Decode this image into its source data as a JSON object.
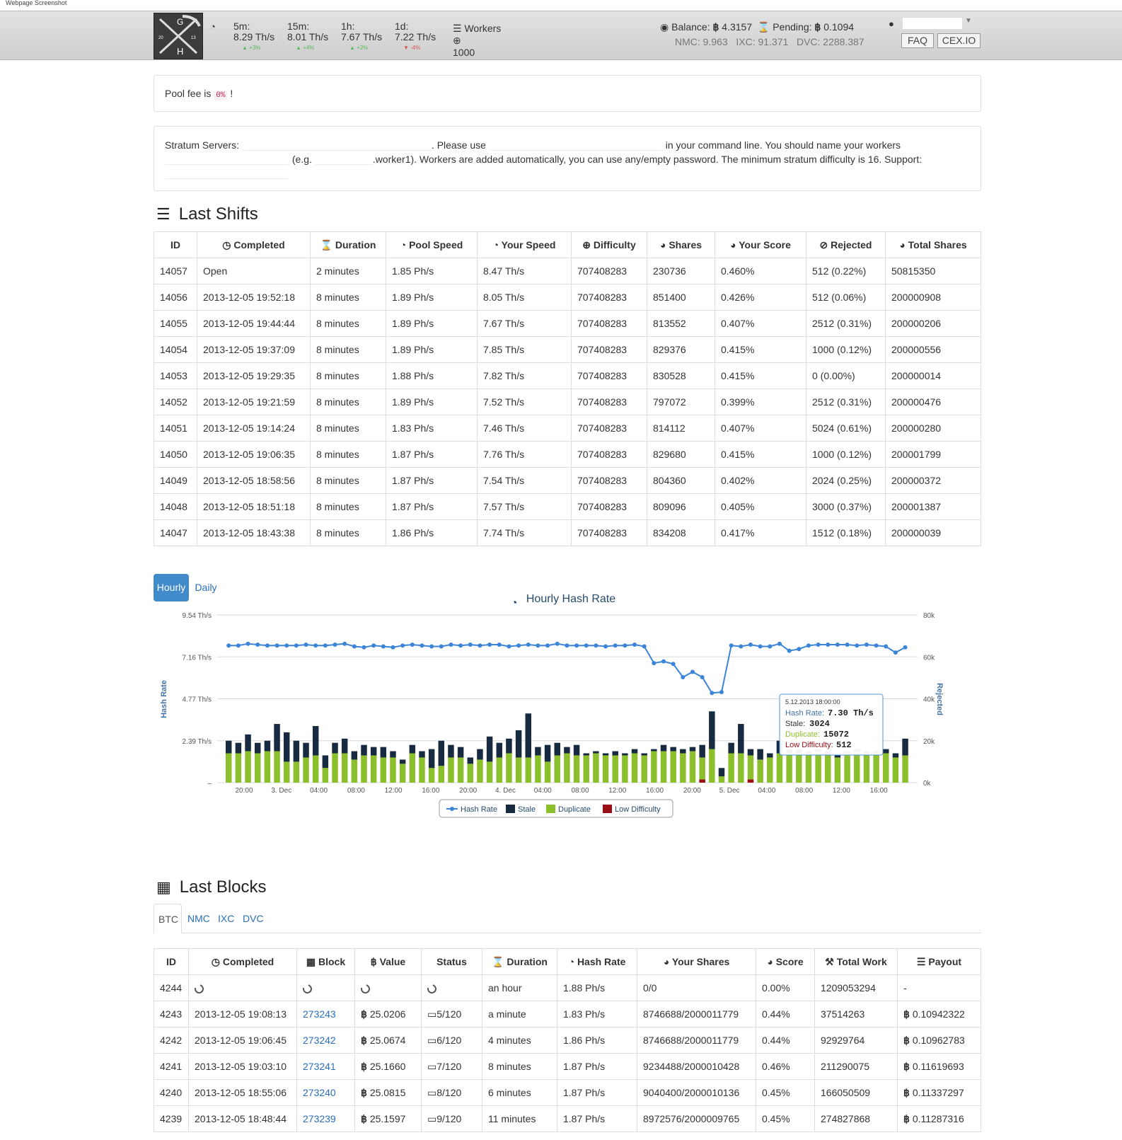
{
  "caption": "Webpage Screenshot",
  "header": {
    "stats": [
      {
        "label": "5m:",
        "value": "8.29 Th/s",
        "delta": "+3%",
        "dir": "up"
      },
      {
        "label": "15m:",
        "value": "8.01 Th/s",
        "delta": "+4%",
        "dir": "up"
      },
      {
        "label": "1h:",
        "value": "7.67 Th/s",
        "delta": "+2%",
        "dir": "up"
      },
      {
        "label": "1d:",
        "value": "7.22 Th/s",
        "delta": "-4%",
        "dir": "down"
      }
    ],
    "workers_label": "Workers",
    "workers_value": "1000",
    "balance_label": "Balance:",
    "balance_value": "4.3157",
    "pending_label": "Pending:",
    "pending_value": "0.1094",
    "alt_balances": "NMC: 9.963   IXC: 91.371   DVC: 2288.387",
    "faq_label": "FAQ",
    "cex_label": "CEX.IO",
    "user_value": ""
  },
  "fee_panel": {
    "prefix": "Pool fee is",
    "fee": "0%",
    "suffix": "!"
  },
  "stratum_panel": {
    "part1": "Stratum Servers:",
    "part2": ". Please use",
    "part3": "in your command line. You should name your workers",
    "part4": "(e.g.",
    "part5": ".worker1). Workers are added automatically, you can use any/empty password. The minimum stratum difficulty is 16. Support:"
  },
  "last_shifts": {
    "title": "Last Shifts",
    "columns": [
      "ID",
      "Completed",
      "Duration",
      "Pool Speed",
      "Your Speed",
      "Difficulty",
      "Shares",
      "Your Score",
      "Rejected",
      "Total Shares"
    ],
    "rows": [
      [
        "14057",
        "Open",
        "2 minutes",
        "1.85 Ph/s",
        "8.47 Th/s",
        "707408283",
        "230736",
        "0.460%",
        "512 (0.22%)",
        "50815350"
      ],
      [
        "14056",
        "2013-12-05 19:52:18",
        "8 minutes",
        "1.89 Ph/s",
        "8.05 Th/s",
        "707408283",
        "851400",
        "0.426%",
        "512 (0.06%)",
        "200000908"
      ],
      [
        "14055",
        "2013-12-05 19:44:44",
        "8 minutes",
        "1.89 Ph/s",
        "7.67 Th/s",
        "707408283",
        "813552",
        "0.407%",
        "2512 (0.31%)",
        "200000206"
      ],
      [
        "14054",
        "2013-12-05 19:37:09",
        "8 minutes",
        "1.89 Ph/s",
        "7.85 Th/s",
        "707408283",
        "829376",
        "0.415%",
        "1000 (0.12%)",
        "200000556"
      ],
      [
        "14053",
        "2013-12-05 19:29:35",
        "8 minutes",
        "1.88 Ph/s",
        "7.82 Th/s",
        "707408283",
        "830528",
        "0.415%",
        "0 (0.00%)",
        "200000014"
      ],
      [
        "14052",
        "2013-12-05 19:21:59",
        "8 minutes",
        "1.89 Ph/s",
        "7.52 Th/s",
        "707408283",
        "797072",
        "0.399%",
        "2512 (0.31%)",
        "200000476"
      ],
      [
        "14051",
        "2013-12-05 19:14:24",
        "8 minutes",
        "1.83 Ph/s",
        "7.46 Th/s",
        "707408283",
        "814112",
        "0.407%",
        "5024 (0.61%)",
        "200000280"
      ],
      [
        "14050",
        "2013-12-05 19:06:35",
        "8 minutes",
        "1.87 Ph/s",
        "7.76 Th/s",
        "707408283",
        "829680",
        "0.415%",
        "1000 (0.12%)",
        "200001799"
      ],
      [
        "14049",
        "2013-12-05 18:58:56",
        "8 minutes",
        "1.87 Ph/s",
        "7.54 Th/s",
        "707408283",
        "804360",
        "0.402%",
        "2024 (0.25%)",
        "200000372"
      ],
      [
        "14048",
        "2013-12-05 18:51:18",
        "8 minutes",
        "1.87 Ph/s",
        "7.57 Th/s",
        "707408283",
        "809096",
        "0.405%",
        "3000 (0.37%)",
        "200001387"
      ],
      [
        "14047",
        "2013-12-05 18:43:38",
        "8 minutes",
        "1.86 Ph/s",
        "7.74 Th/s",
        "707408283",
        "834208",
        "0.417%",
        "1512 (0.18%)",
        "200000039"
      ]
    ]
  },
  "chart_tabs": [
    "Hourly",
    "Daily"
  ],
  "chart_data": {
    "type": "line",
    "title": "Hourly Hash Rate",
    "ylabel": "Hash Rate",
    "y2label": "Rejected",
    "yticks": [
      "9.54 Th/s",
      "7.16 Th/s",
      "4.77 Th/s",
      "2.39 Th/s",
      "–"
    ],
    "y2ticks": [
      "80k",
      "60k",
      "40k",
      "20k",
      "0k"
    ],
    "ylim": [
      0,
      9.54
    ],
    "y2lim": [
      0,
      80000
    ],
    "xticks": [
      "20:00",
      "3. Dec",
      "04:00",
      "08:00",
      "12:00",
      "16:00",
      "20:00",
      "4. Dec",
      "04:00",
      "08:00",
      "12:00",
      "16:00",
      "20:00",
      "5. Dec",
      "04:00",
      "08:00",
      "12:00",
      "16:00"
    ],
    "legend": [
      "Hash Rate",
      "Stale",
      "Duplicate",
      "Low Difficulty"
    ],
    "colors": {
      "hash": "#3b84d8",
      "stale": "#172a40",
      "dup": "#8cbf2c",
      "low": "#9b0c14"
    },
    "hash_rate": [
      7.8,
      7.8,
      7.9,
      7.85,
      7.8,
      7.8,
      7.8,
      7.8,
      7.85,
      7.8,
      7.8,
      7.85,
      7.9,
      7.75,
      7.7,
      7.8,
      7.75,
      7.7,
      7.8,
      7.85,
      7.8,
      7.75,
      7.75,
      7.85,
      7.8,
      7.85,
      7.8,
      7.85,
      7.85,
      7.75,
      7.8,
      7.85,
      7.8,
      7.8,
      7.9,
      7.8,
      7.8,
      7.8,
      7.8,
      7.75,
      7.8,
      7.8,
      7.85,
      7.75,
      6.8,
      6.9,
      6.75,
      6.0,
      6.3,
      6.0,
      5.1,
      5.15,
      7.8,
      7.75,
      7.85,
      7.75,
      7.75,
      7.9,
      7.5,
      7.6,
      7.8,
      7.85,
      7.85,
      7.85,
      7.85,
      7.8,
      7.85,
      7.8,
      7.75,
      7.4,
      7.7
    ],
    "stale": [
      6000,
      5000,
      8000,
      5000,
      5000,
      13000,
      14000,
      10000,
      7000,
      14000,
      6000,
      5000,
      7000,
      4000,
      5000,
      4000,
      5000,
      3000,
      2000,
      4000,
      3000,
      9000,
      12000,
      6000,
      5000,
      3000,
      5000,
      12000,
      7000,
      7000,
      13000,
      21000,
      4000,
      8000,
      6000,
      3000,
      5000,
      1000,
      1000,
      1000,
      2000,
      1000,
      2000,
      1000,
      1000,
      3000,
      2000,
      2000,
      2000,
      6000,
      18000,
      4000,
      5000,
      14000,
      3000,
      5000,
      2000,
      6000,
      2000,
      2000,
      1000,
      1000,
      2000,
      1000,
      1000,
      1000,
      1000,
      1000,
      2000,
      2000,
      8000
    ],
    "duplicate": [
      14000,
      14000,
      15000,
      14000,
      15000,
      15000,
      10000,
      10000,
      12000,
      13000,
      7000,
      14000,
      14000,
      11000,
      13000,
      13000,
      12000,
      12000,
      9000,
      14000,
      12000,
      7000,
      8000,
      12000,
      12000,
      9000,
      11000,
      10000,
      12000,
      14000,
      12000,
      12000,
      13000,
      10000,
      13000,
      14000,
      13000,
      13000,
      14000,
      13000,
      13000,
      13000,
      14000,
      13000,
      15000,
      15000,
      15000,
      14000,
      15000,
      12000,
      16000,
      3000,
      14000,
      14000,
      13000,
      11000,
      12000,
      14000,
      14000,
      14000,
      14000,
      15000,
      13000,
      12000,
      14000,
      15000,
      14000,
      14000,
      14000,
      12000,
      13000
    ],
    "low_difficulty": [
      0,
      0,
      0,
      0,
      0,
      0,
      0,
      0,
      0,
      0,
      0,
      0,
      0,
      0,
      0,
      0,
      0,
      0,
      0,
      0,
      0,
      0,
      0,
      0,
      0,
      0,
      0,
      0,
      0,
      0,
      0,
      0,
      0,
      0,
      0,
      0,
      0,
      0,
      0,
      0,
      0,
      0,
      0,
      0,
      0,
      0,
      0,
      0,
      0,
      1500,
      0,
      0,
      0,
      0,
      1500,
      0,
      0,
      0,
      0,
      0,
      0,
      0,
      0,
      0,
      0,
      0,
      0,
      0,
      0,
      0,
      0
    ],
    "tooltip": {
      "time": "5.12.2013 18:00:00",
      "hash_label": "Hash Rate:",
      "hash_value": "7.30 Th/s",
      "stale_label": "Stale:",
      "stale_value": "3024",
      "dup_label": "Duplicate:",
      "dup_value": "15072",
      "low_label": "Low Difficulty:",
      "low_value": "512"
    }
  },
  "last_blocks": {
    "title": "Last Blocks",
    "tabs": [
      "BTC",
      "NMC",
      "IXC",
      "DVC"
    ],
    "columns": [
      "ID",
      "Completed",
      "Block",
      "Value",
      "Status",
      "Duration",
      "Hash Rate",
      "Your Shares",
      "Score",
      "Total Work",
      "Payout"
    ],
    "rows": [
      {
        "id": "4244",
        "completed": "",
        "block": "",
        "value": "",
        "status": "",
        "duration": "an hour",
        "hashrate": "1.88 Ph/s",
        "shares": "0/0",
        "score": "0.00%",
        "work": "1209053294",
        "payout": "-",
        "pending": true
      },
      {
        "id": "4243",
        "completed": "2013-12-05 19:08:13",
        "block": "273243",
        "value": "25.0206",
        "status": "5/120",
        "duration": "a minute",
        "hashrate": "1.83 Ph/s",
        "shares": "8746688/2000011779",
        "score": "0.44%",
        "work": "37514263",
        "payout": "0.10942322"
      },
      {
        "id": "4242",
        "completed": "2013-12-05 19:06:45",
        "block": "273242",
        "value": "25.0674",
        "status": "6/120",
        "duration": "4 minutes",
        "hashrate": "1.86 Ph/s",
        "shares": "8746688/2000011779",
        "score": "0.44%",
        "work": "92929764",
        "payout": "0.10962783"
      },
      {
        "id": "4241",
        "completed": "2013-12-05 19:03:10",
        "block": "273241",
        "value": "25.1660",
        "status": "7/120",
        "duration": "8 minutes",
        "hashrate": "1.87 Ph/s",
        "shares": "9234488/2000010428",
        "score": "0.46%",
        "work": "211290075",
        "payout": "0.11619693"
      },
      {
        "id": "4240",
        "completed": "2013-12-05 18:55:06",
        "block": "273240",
        "value": "25.0815",
        "status": "8/120",
        "duration": "6 minutes",
        "hashrate": "1.87 Ph/s",
        "shares": "9040400/2000010136",
        "score": "0.45%",
        "work": "166050509",
        "payout": "0.11337297"
      },
      {
        "id": "4239",
        "completed": "2013-12-05 18:48:44",
        "block": "273239",
        "value": "25.1597",
        "status": "9/120",
        "duration": "11 minutes",
        "hashrate": "1.87 Ph/s",
        "shares": "8972576/2000009765",
        "score": "0.45%",
        "work": "274827868",
        "payout": "0.11287316"
      }
    ]
  }
}
